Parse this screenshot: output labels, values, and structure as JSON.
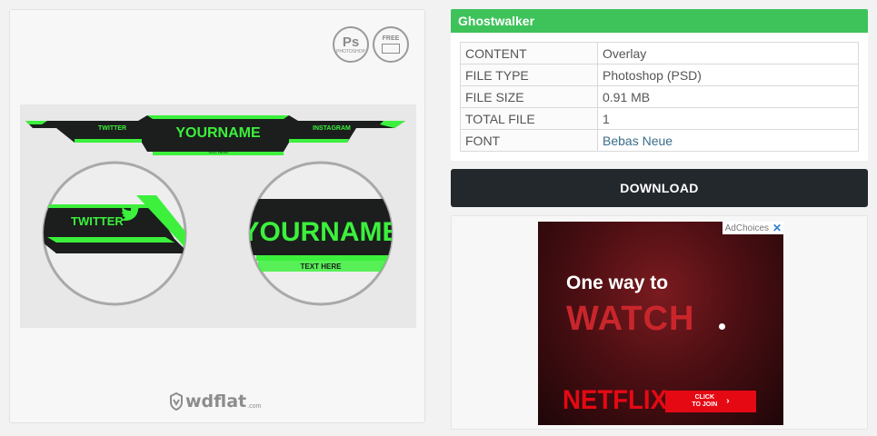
{
  "preview": {
    "badge_ps": "Ps",
    "badge_ps_sub": "PHOTOSHOP",
    "badge_free": "FREE",
    "art": {
      "twitter_top": "TWITTER",
      "yourname_top": "YOURNAME",
      "instagram_top": "INSTAGRAM",
      "text_here_top": "TEXT HERE",
      "twitter_zoom": "TWITTER",
      "yourname_zoom": "YOURNAME",
      "text_here_zoom": "TEXT HERE",
      "accent": "#3cf03c",
      "dark": "#1b1e1d"
    },
    "brand": "wdflat",
    "brand_suffix": ".com"
  },
  "info": {
    "title": "Ghostwalker",
    "header_color": "#3ec35a",
    "rows": [
      {
        "key": "CONTENT",
        "value": "Overlay"
      },
      {
        "key": "FILE TYPE",
        "value": "Photoshop (PSD)"
      },
      {
        "key": "FILE SIZE",
        "value": "0.91 MB"
      },
      {
        "key": "TOTAL FILE",
        "value": "1"
      },
      {
        "key": "FONT",
        "value": "Bebas Neue"
      }
    ]
  },
  "download_label": "DOWNLOAD",
  "ad": {
    "adchoices": "AdChoices",
    "close": "✕",
    "line1": "One way to",
    "line2": "WATCH",
    "brand": "NETFLIX",
    "cta_line1": "CLICK",
    "cta_line2": "TO JOIN",
    "cta_arrow": "›"
  }
}
